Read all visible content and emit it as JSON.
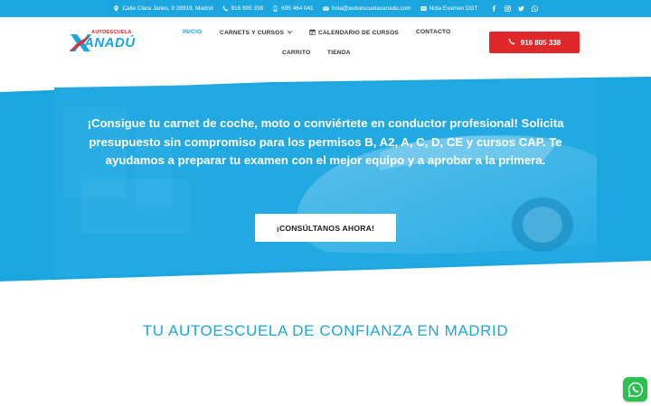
{
  "topbar": {
    "address": "Calle Clara Janes, 9 28919, Madrid",
    "phone": "916 805 338",
    "mobile": "695 464 041",
    "email": "hola@autoescuelaxanadu.com",
    "exam": "Nota Examen DGT",
    "social": [
      "facebook-icon",
      "instagram-icon",
      "twitter-icon",
      "whatsapp-icon"
    ]
  },
  "logo": {
    "top": "AUTOESCUELA",
    "name": "ANADÚ"
  },
  "nav": {
    "inicio": "INICIO",
    "carnets": "CARNETS Y CURSOS",
    "calendario": "CALENDARIO DE CURSOS",
    "contacto": "CONTACTO",
    "carrito": "CARRITO",
    "tienda": "TIENDA"
  },
  "call_button": "916 805 338",
  "hero": {
    "text": "¡Consigue tu carnet de coche, moto o conviértete en conductor profesional! Solicita presupuesto sin compromiso para los permisos B, A2, A, C, D, CE y cursos CAP. Te ayudamos a preparar tu examen con el mejor equipo y a aprobar a la primera.",
    "button": "¡CONSÚLTANOS AHORA!"
  },
  "section_title": "TU AUTOESCUELA DE CONFIANZA EN MADRID",
  "colors": {
    "accent": "#1ba6e0",
    "brand_red": "#e0282a",
    "whatsapp": "#2dbf4f"
  }
}
